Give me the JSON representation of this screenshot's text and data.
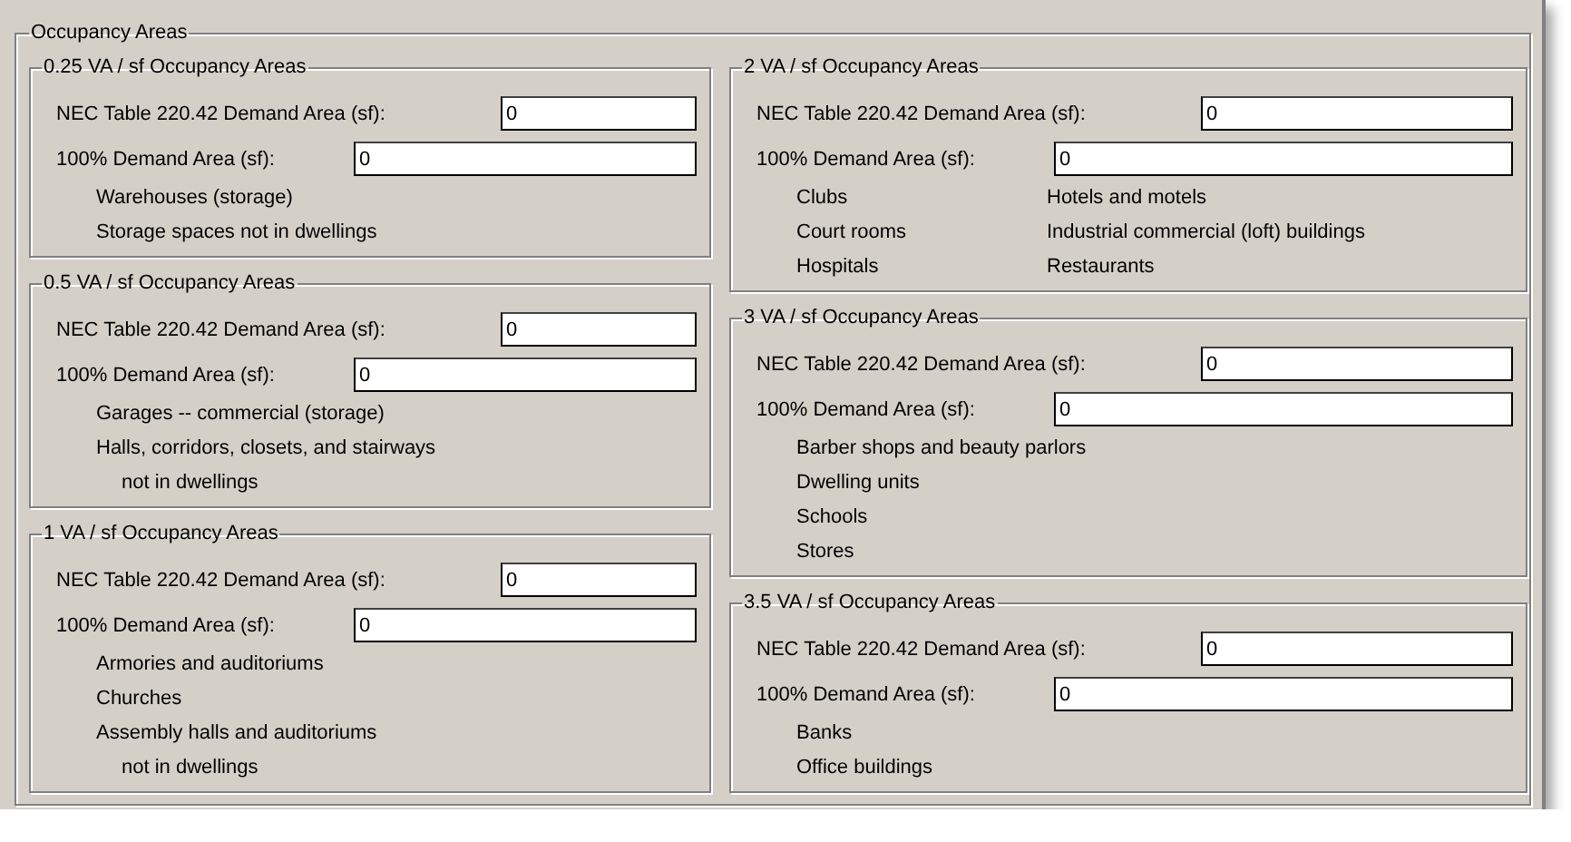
{
  "panel": {
    "title": "Occupancy Areas"
  },
  "columns": [
    [
      {
        "title": "0.25 VA / sf Occupancy Areas",
        "table_field": {
          "label": "NEC Table 220.42 Demand Area (sf):",
          "value": "0"
        },
        "full_field": {
          "label": "100% Demand Area (sf):",
          "value": "0"
        },
        "item_columns": [
          [
            {
              "text": "Warehouses (storage)",
              "kind": "item"
            },
            {
              "text": "Storage spaces not in dwellings",
              "kind": "item"
            }
          ]
        ]
      },
      {
        "title": "0.5 VA / sf Occupancy Areas",
        "table_field": {
          "label": "NEC Table 220.42 Demand Area (sf):",
          "value": "0"
        },
        "full_field": {
          "label": "100% Demand Area (sf):",
          "value": "0"
        },
        "item_columns": [
          [
            {
              "text": "Garages -- commercial (storage)",
              "kind": "item"
            },
            {
              "text": "Halls, corridors, closets, and stairways",
              "kind": "item"
            },
            {
              "text": "not in dwellings",
              "kind": "continuation"
            }
          ]
        ]
      },
      {
        "title": "1 VA / sf Occupancy Areas",
        "table_field": {
          "label": "NEC Table 220.42 Demand Area (sf):",
          "value": "0"
        },
        "full_field": {
          "label": "100% Demand Area (sf):",
          "value": "0"
        },
        "item_columns": [
          [
            {
              "text": "Armories and auditoriums",
              "kind": "item"
            },
            {
              "text": "Churches",
              "kind": "item"
            },
            {
              "text": "Assembly halls and auditoriums",
              "kind": "item"
            },
            {
              "text": "not in dwellings",
              "kind": "continuation"
            }
          ]
        ]
      }
    ],
    [
      {
        "title": "2 VA / sf Occupancy Areas",
        "table_field": {
          "label": "NEC Table 220.42 Demand Area (sf):",
          "value": "0"
        },
        "full_field": {
          "label": "100% Demand Area (sf):",
          "value": "0"
        },
        "item_columns": [
          [
            {
              "text": "Clubs",
              "kind": "item"
            },
            {
              "text": "Court rooms",
              "kind": "item"
            },
            {
              "text": "Hospitals",
              "kind": "item"
            }
          ],
          [
            {
              "text": "Hotels and motels",
              "kind": "item"
            },
            {
              "text": "Industrial commercial (loft) buildings",
              "kind": "item"
            },
            {
              "text": "Restaurants",
              "kind": "item"
            }
          ]
        ]
      },
      {
        "title": "3 VA / sf Occupancy Areas",
        "table_field": {
          "label": "NEC Table 220.42 Demand Area (sf):",
          "value": "0"
        },
        "full_field": {
          "label": "100% Demand Area (sf):",
          "value": "0"
        },
        "item_columns": [
          [
            {
              "text": "Barber shops and beauty parlors",
              "kind": "item"
            },
            {
              "text": "Dwelling units",
              "kind": "item"
            },
            {
              "text": "Schools",
              "kind": "item"
            },
            {
              "text": "Stores",
              "kind": "item"
            }
          ]
        ]
      },
      {
        "title": "3.5 VA / sf Occupancy Areas",
        "table_field": {
          "label": "NEC Table 220.42 Demand Area (sf):",
          "value": "0"
        },
        "full_field": {
          "label": "100% Demand Area (sf):",
          "value": "0"
        },
        "item_columns": [
          [
            {
              "text": "Banks",
              "kind": "item"
            },
            {
              "text": "Office buildings",
              "kind": "item"
            }
          ]
        ]
      }
    ]
  ]
}
